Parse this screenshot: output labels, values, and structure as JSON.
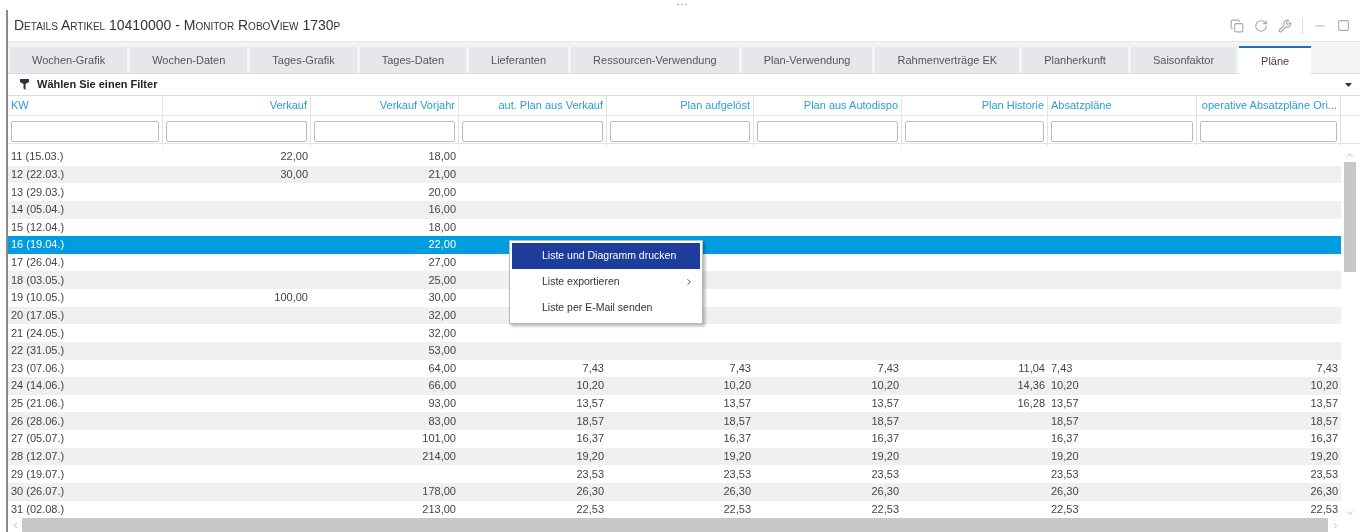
{
  "window": {
    "title": "Details Artikel 10410000 - Monitor RoboView 1730p"
  },
  "tabs": [
    {
      "label": "Wochen-Grafik",
      "selected": false
    },
    {
      "label": "Wochen-Daten",
      "selected": false
    },
    {
      "label": "Tages-Grafik",
      "selected": false
    },
    {
      "label": "Tages-Daten",
      "selected": false
    },
    {
      "label": "Lieferanten",
      "selected": false
    },
    {
      "label": "Ressourcen-Verwendung",
      "selected": false
    },
    {
      "label": "Plan-Verwendung",
      "selected": false
    },
    {
      "label": "Rahmenverträge EK",
      "selected": false
    },
    {
      "label": "Planherkunft",
      "selected": false
    },
    {
      "label": "Saisonfaktor",
      "selected": false
    },
    {
      "label": "Pläne",
      "selected": true
    }
  ],
  "filter": {
    "label": "Wählen Sie einen Filter"
  },
  "table": {
    "columns": [
      {
        "label": "KW",
        "kind": "text"
      },
      {
        "label": "Verkauf",
        "kind": "number"
      },
      {
        "label": "Verkauf Vorjahr",
        "kind": "number"
      },
      {
        "label": "aut. Plan aus Verkauf",
        "kind": "number"
      },
      {
        "label": "Plan aufgelöst",
        "kind": "number"
      },
      {
        "label": "Plan aus Autodispo",
        "kind": "number"
      },
      {
        "label": "Plan Historie",
        "kind": "number"
      },
      {
        "label": "Absatzpläne",
        "kind": "text"
      },
      {
        "label": "operative Absatzpläne Ori...",
        "kind": "number"
      }
    ],
    "rows": [
      {
        "selected": false,
        "cells": [
          "11 (15.03.)",
          "22,00",
          "18,00",
          null,
          null,
          null,
          null,
          null,
          null
        ]
      },
      {
        "selected": false,
        "cells": [
          "12 (22.03.)",
          "30,00",
          "21,00",
          null,
          null,
          null,
          null,
          null,
          null
        ]
      },
      {
        "selected": false,
        "cells": [
          "13 (29.03.)",
          null,
          "20,00",
          null,
          null,
          null,
          null,
          null,
          null
        ]
      },
      {
        "selected": false,
        "cells": [
          "14 (05.04.)",
          null,
          "16,00",
          null,
          null,
          null,
          null,
          null,
          null
        ]
      },
      {
        "selected": false,
        "cells": [
          "15 (12.04.)",
          null,
          "18,00",
          null,
          null,
          null,
          null,
          null,
          null
        ]
      },
      {
        "selected": true,
        "cells": [
          "16 (19.04.)",
          null,
          "22,00",
          null,
          null,
          null,
          null,
          null,
          null
        ]
      },
      {
        "selected": false,
        "cells": [
          "17 (26.04.)",
          null,
          "27,00",
          null,
          null,
          null,
          null,
          null,
          null
        ]
      },
      {
        "selected": false,
        "cells": [
          "18 (03.05.)",
          null,
          "25,00",
          null,
          null,
          null,
          null,
          null,
          null
        ]
      },
      {
        "selected": false,
        "cells": [
          "19 (10.05.)",
          "100,00",
          "30,00",
          null,
          null,
          null,
          null,
          null,
          null
        ]
      },
      {
        "selected": false,
        "cells": [
          "20 (17.05.)",
          null,
          "32,00",
          null,
          null,
          null,
          null,
          null,
          null
        ]
      },
      {
        "selected": false,
        "cells": [
          "21 (24.05.)",
          null,
          "32,00",
          null,
          null,
          null,
          null,
          null,
          null
        ]
      },
      {
        "selected": false,
        "cells": [
          "22 (31.05.)",
          null,
          "53,00",
          null,
          null,
          null,
          null,
          null,
          null
        ]
      },
      {
        "selected": false,
        "cells": [
          "23 (07.06.)",
          null,
          "64,00",
          "7,43",
          "7,43",
          "7,43",
          "11,04",
          "7,43",
          "7,43"
        ]
      },
      {
        "selected": false,
        "cells": [
          "24 (14.06.)",
          null,
          "66,00",
          "10,20",
          "10,20",
          "10,20",
          "14,36",
          "10,20",
          "10,20"
        ]
      },
      {
        "selected": false,
        "cells": [
          "25 (21.06.)",
          null,
          "93,00",
          "13,57",
          "13,57",
          "13,57",
          "16,28",
          "13,57",
          "13,57"
        ]
      },
      {
        "selected": false,
        "cells": [
          "26 (28.06.)",
          null,
          "83,00",
          "18,57",
          "18,57",
          "18,57",
          null,
          "18,57",
          "18,57"
        ]
      },
      {
        "selected": false,
        "cells": [
          "27 (05.07.)",
          null,
          "101,00",
          "16,37",
          "16,37",
          "16,37",
          null,
          "16,37",
          "16,37"
        ]
      },
      {
        "selected": false,
        "cells": [
          "28 (12.07.)",
          null,
          "214,00",
          "19,20",
          "19,20",
          "19,20",
          null,
          "19,20",
          "19,20"
        ]
      },
      {
        "selected": false,
        "cells": [
          "29 (19.07.)",
          null,
          null,
          "23,53",
          "23,53",
          "23,53",
          null,
          "23,53",
          "23,53"
        ]
      },
      {
        "selected": false,
        "cells": [
          "30 (26.07.)",
          null,
          "178,00",
          "26,30",
          "26,30",
          "26,30",
          null,
          "26,30",
          "26,30"
        ]
      },
      {
        "selected": false,
        "cells": [
          "31 (02.08.)",
          null,
          "213,00",
          "22,53",
          "22,53",
          "22,53",
          null,
          "22,53",
          "22,53"
        ]
      }
    ]
  },
  "context_menu": {
    "items": [
      {
        "label": "Liste und Diagramm drucken",
        "selected": true,
        "submenu": false
      },
      {
        "label": "Liste exportieren",
        "selected": false,
        "submenu": true
      },
      {
        "label": "Liste per E-Mail senden",
        "selected": false,
        "submenu": false
      }
    ]
  }
}
